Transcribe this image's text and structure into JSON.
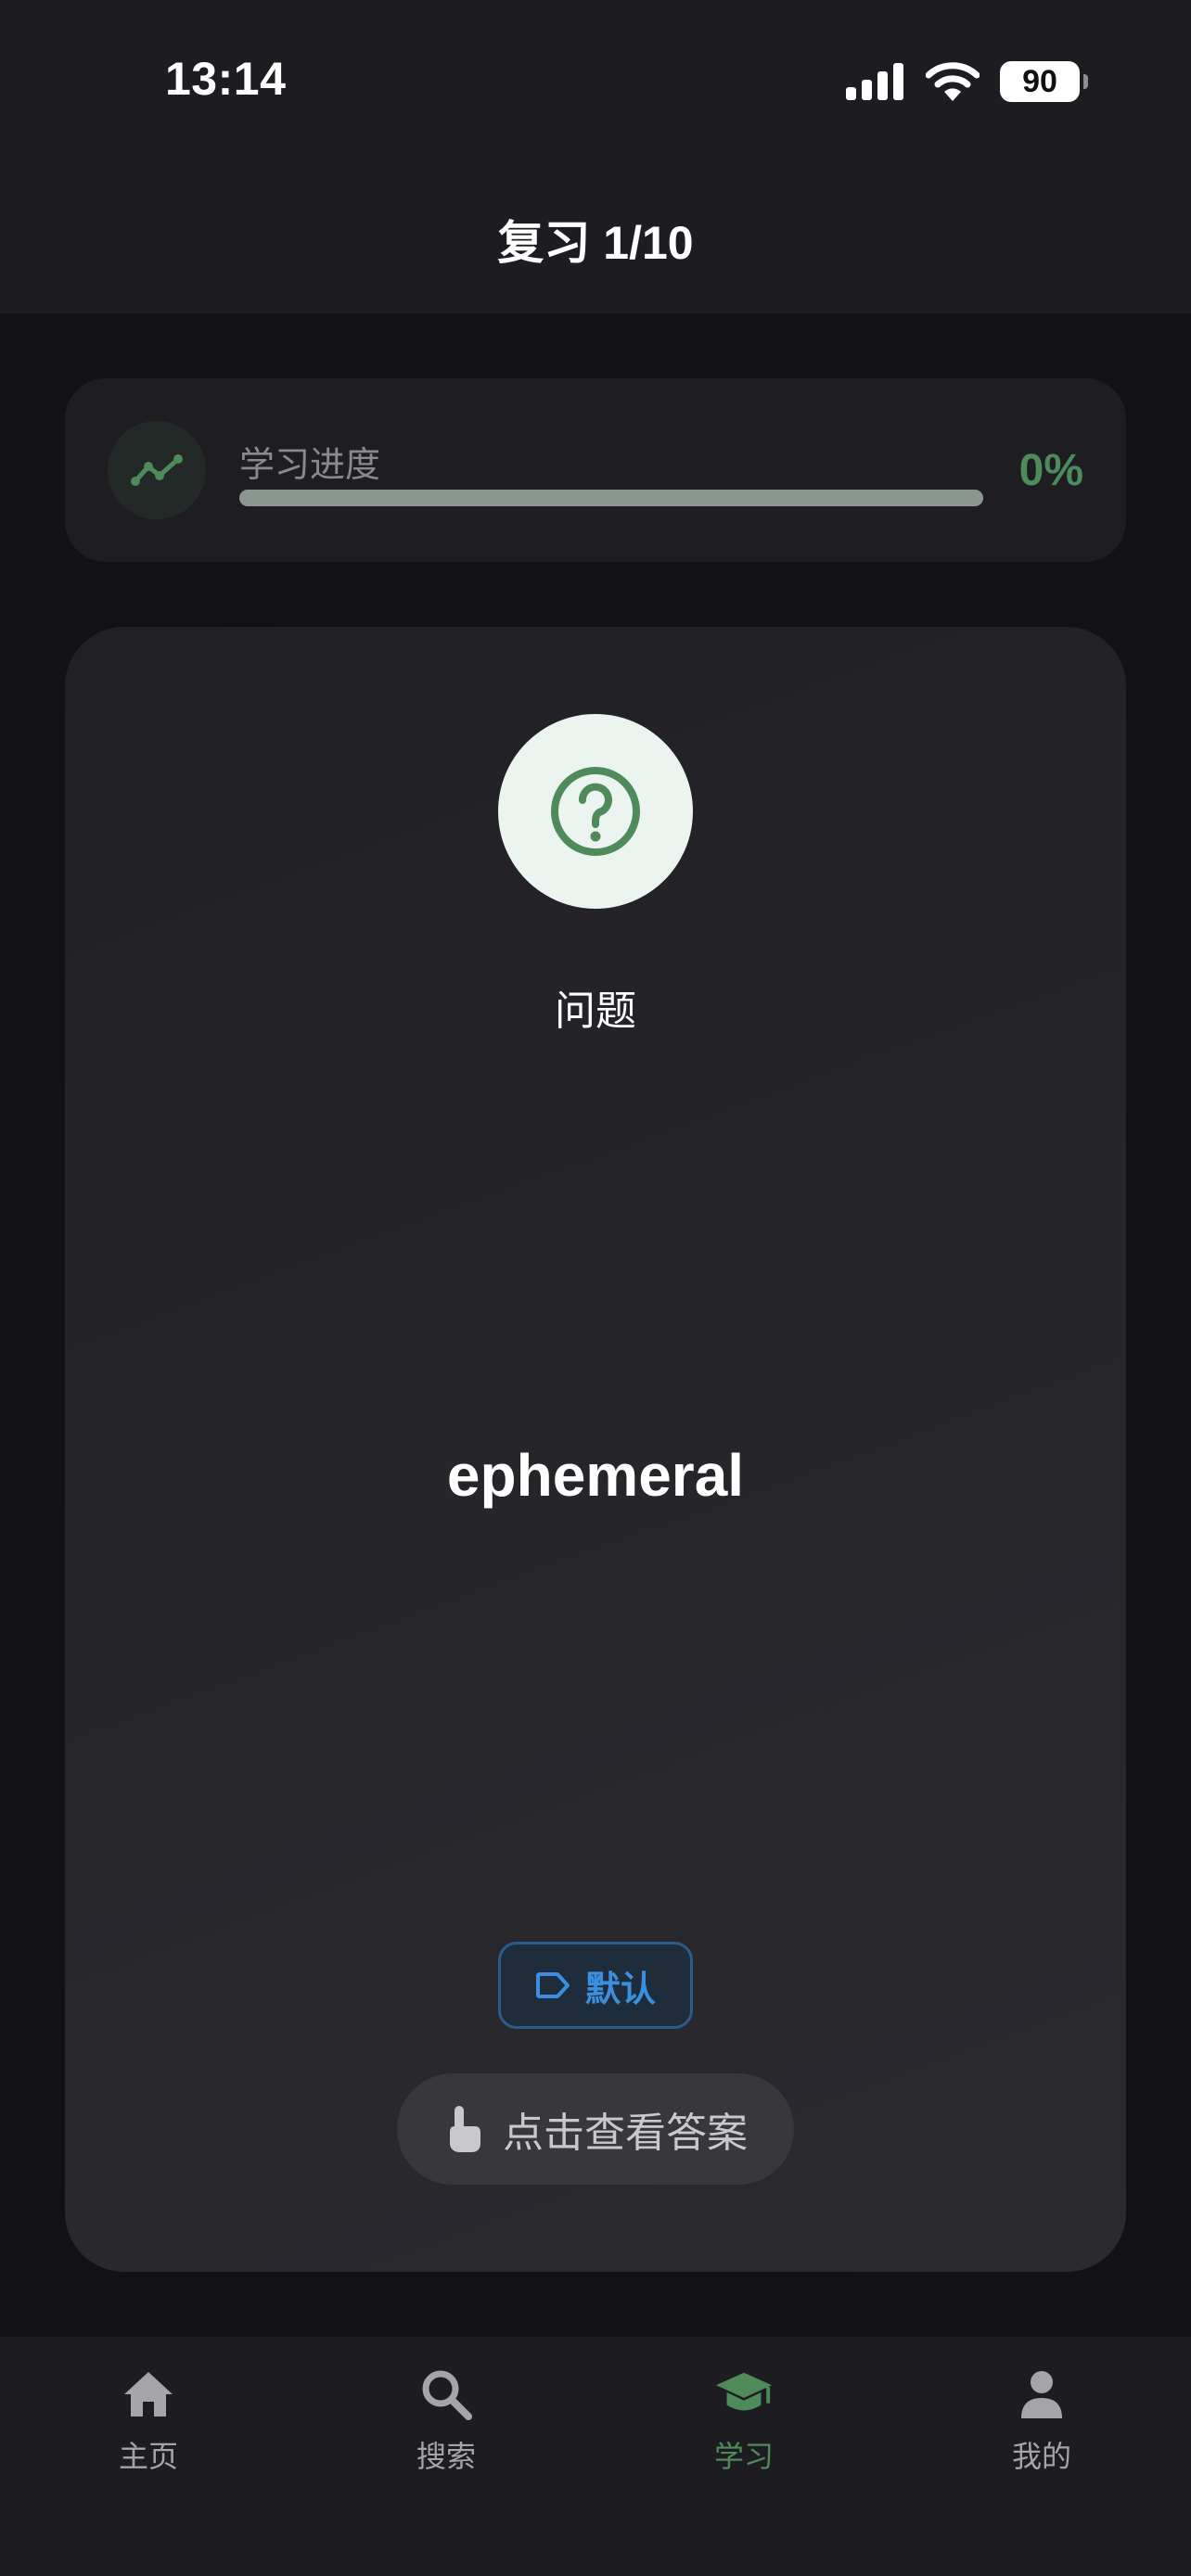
{
  "status_bar": {
    "time": "13:14",
    "battery": "90",
    "icons": [
      "signal-icon",
      "wifi-icon",
      "battery-icon"
    ]
  },
  "nav": {
    "title": "复习 1/10"
  },
  "progress": {
    "icon": "trend-chart-icon",
    "label": "学习进度",
    "percent_text": "0%",
    "value": 0
  },
  "card": {
    "icon": "question-icon",
    "side_label": "问题",
    "word": "ephemeral",
    "tag": {
      "icon": "tag-icon",
      "label": "默认"
    },
    "reveal_button": {
      "icon": "tap-hand-icon",
      "label": "点击查看答案"
    }
  },
  "tabs": [
    {
      "label": "主页",
      "icon": "home-icon",
      "active": false
    },
    {
      "label": "搜索",
      "icon": "search-icon",
      "active": false
    },
    {
      "label": "学习",
      "icon": "graduation-cap-icon",
      "active": true
    },
    {
      "label": "我的",
      "icon": "person-icon",
      "active": false
    }
  ],
  "colors": {
    "accent": "#4f8a5b",
    "tag_blue": "#3a8fe0",
    "background": "#121214",
    "card": "#26262b"
  }
}
